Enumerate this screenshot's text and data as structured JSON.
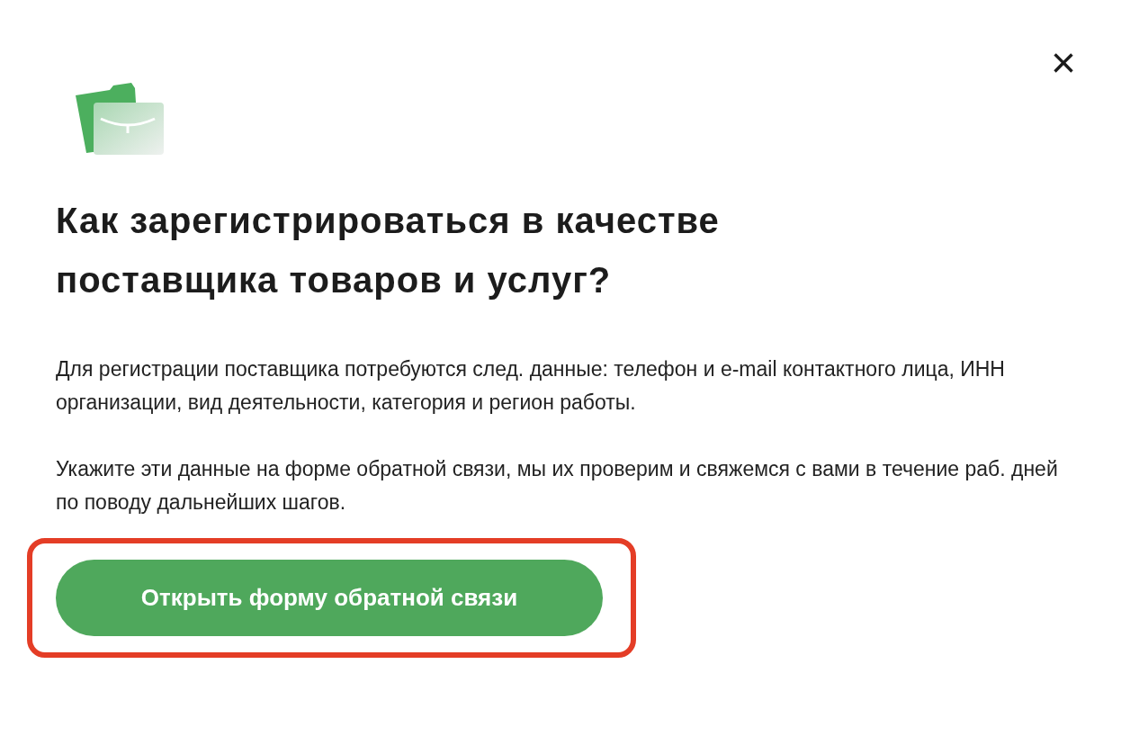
{
  "close_button": {
    "label": "×"
  },
  "title": "Как зарегистрироваться в качестве поставщика товаров и услуг?",
  "paragraphs": [
    "Для регистрации поставщика потребуются след. данные: телефон и e-mail контактного лица, ИНН организации, вид деятельности, категория и регион работы.",
    "Укажите эти данные на форме обратной связи, мы их проверим и свяжемся с вами в течение раб. дней по поводу дальнейших шагов."
  ],
  "button": {
    "label": "Открыть форму обратной связи",
    "highlighted": true
  }
}
